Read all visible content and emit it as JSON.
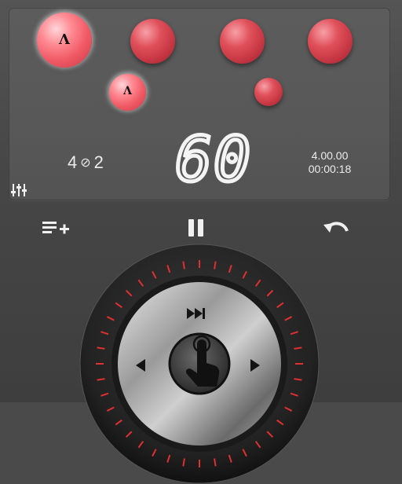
{
  "display": {
    "beats": [
      {
        "accent": true,
        "mark": "Λ"
      },
      {
        "accent": false,
        "mark": ""
      },
      {
        "accent": false,
        "mark": ""
      },
      {
        "accent": false,
        "mark": ""
      },
      {
        "accent": true,
        "mark": "Λ"
      },
      {
        "accent": false,
        "mark": ""
      }
    ],
    "meter_top": "4",
    "meter_symbol": "⊘",
    "meter_bottom": "2",
    "tempo": "60",
    "time_signature_value": "4.00.00",
    "elapsed": "00:00:18"
  },
  "icons": {
    "mixer": "sliders-icon",
    "add_list": "playlist-add-icon",
    "pause": "pause-icon",
    "undo": "undo-icon",
    "fast_forward": "fast-forward-icon",
    "left": "arrow-left-icon",
    "right": "arrow-right-icon",
    "tap": "tap-hand-icon"
  },
  "colors": {
    "ball": "#d8444f",
    "tick": "#e03030",
    "digits": "#f4f4f4"
  }
}
